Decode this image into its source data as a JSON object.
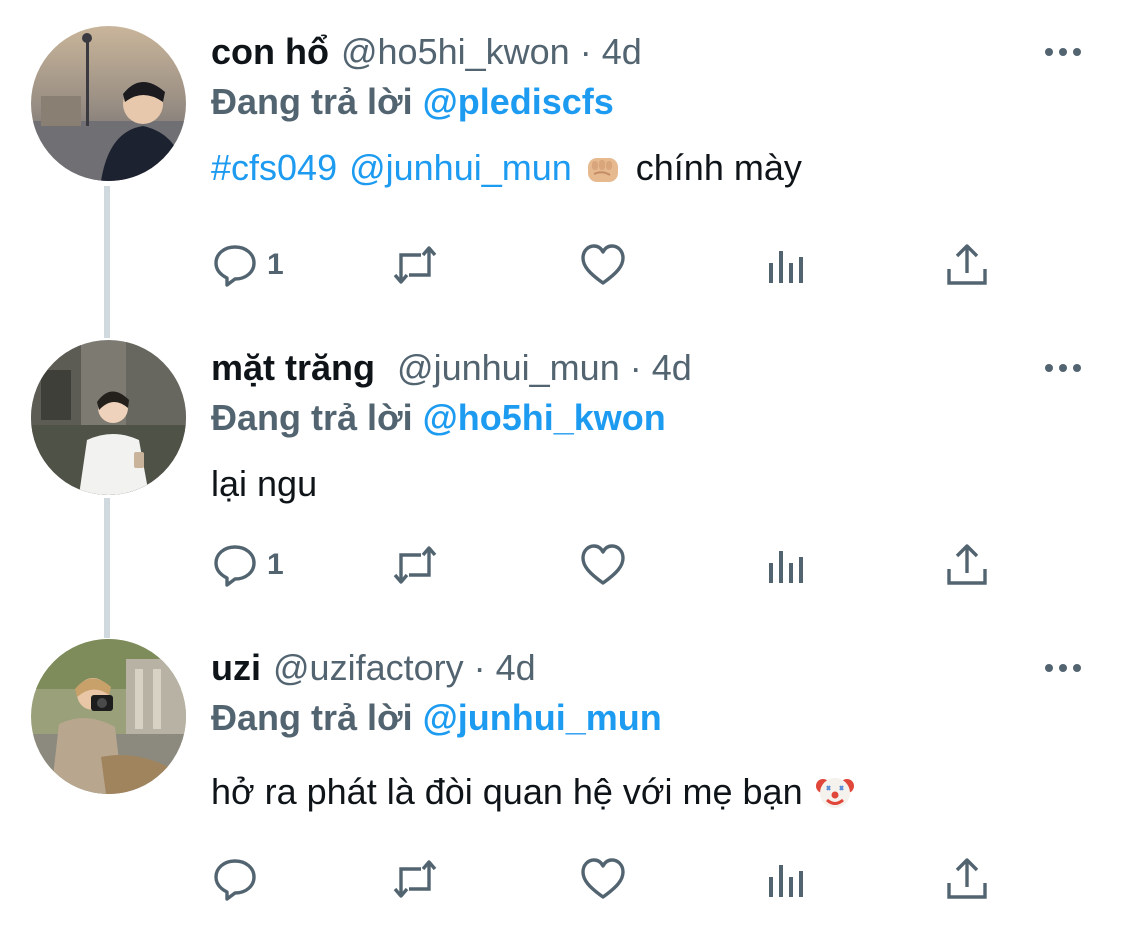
{
  "colors": {
    "link": "#1d9bf0",
    "secondary_text": "#536471",
    "thread_line": "#cfd9de",
    "icon": "#536471"
  },
  "tweets": [
    {
      "display_name": "con hổ",
      "handle": "@ho5hi_kwon",
      "separator": "·",
      "time": "4d",
      "reply_label": "Đang trả lời",
      "reply_to": "@plediscfs",
      "body": {
        "hashtag": "#cfs049",
        "mention": "@junhui_mun",
        "emoji": "pointing-fist-emoji",
        "text": "chính mày"
      },
      "reply_count": "1"
    },
    {
      "display_name": "mặt trăng",
      "handle": "@junhui_mun",
      "separator": "·",
      "time": "4d",
      "reply_label": "Đang trả lời",
      "reply_to": "@ho5hi_kwon",
      "body": {
        "text": "lại ngu"
      },
      "reply_count": "1"
    },
    {
      "display_name": "uzi",
      "handle": "@uzifactory",
      "separator": "·",
      "time": "4d",
      "reply_label": "Đang trả lời",
      "reply_to": "@junhui_mun",
      "body": {
        "text": "hở ra phát là đòi quan hệ với mẹ bạn",
        "emoji": "clown-face-emoji"
      },
      "reply_count": ""
    }
  ],
  "icons": {
    "reply": "reply-icon",
    "retweet": "retweet-icon",
    "like": "heart-icon",
    "views": "views-icon",
    "share": "share-icon",
    "more": "more-icon"
  }
}
